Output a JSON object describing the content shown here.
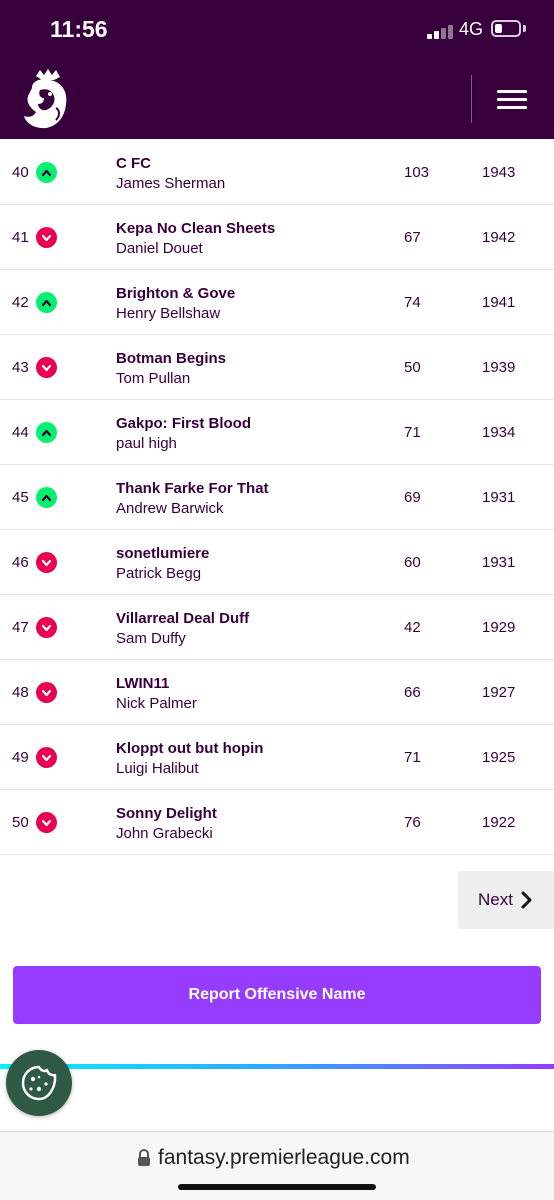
{
  "status_bar": {
    "time": "11:56",
    "network": "4G",
    "battery_level": 0.3
  },
  "header": {
    "logo_icon": "premier-league-lion-icon",
    "menu_icon": "hamburger-menu-icon"
  },
  "colors": {
    "brand_purple": "#37003c",
    "up_green": "#05f06e",
    "down_pink": "#e90052",
    "report_purple": "#963cff"
  },
  "rows": [
    {
      "rank": "40",
      "movement": "up",
      "team": "C FC",
      "manager": "James Sherman",
      "gw": "103",
      "total": "1943"
    },
    {
      "rank": "41",
      "movement": "down",
      "team": "Kepa No Clean Sheets",
      "manager": "Daniel Douet",
      "gw": "67",
      "total": "1942"
    },
    {
      "rank": "42",
      "movement": "up",
      "team": "Brighton & Gove",
      "manager": "Henry Bellshaw",
      "gw": "74",
      "total": "1941"
    },
    {
      "rank": "43",
      "movement": "down",
      "team": "Botman Begins",
      "manager": "Tom Pullan",
      "gw": "50",
      "total": "1939"
    },
    {
      "rank": "44",
      "movement": "up",
      "team": "Gakpo: First Blood",
      "manager": "paul high",
      "gw": "71",
      "total": "1934"
    },
    {
      "rank": "45",
      "movement": "up",
      "team": "Thank Farke For That",
      "manager": "Andrew Barwick",
      "gw": "69",
      "total": "1931"
    },
    {
      "rank": "46",
      "movement": "down",
      "team": "sonetlumiere",
      "manager": "Patrick Begg",
      "gw": "60",
      "total": "1931"
    },
    {
      "rank": "47",
      "movement": "down",
      "team": "Villarreal Deal Duff",
      "manager": "Sam Duffy",
      "gw": "42",
      "total": "1929"
    },
    {
      "rank": "48",
      "movement": "down",
      "team": "LWIN11",
      "manager": "Nick Palmer",
      "gw": "66",
      "total": "1927"
    },
    {
      "rank": "49",
      "movement": "down",
      "team": "Kloppt out but hopin",
      "manager": "Luigi Halibut",
      "gw": "71",
      "total": "1925"
    },
    {
      "rank": "50",
      "movement": "down",
      "team": "Sonny Delight",
      "manager": "John Grabecki",
      "gw": "76",
      "total": "1922"
    }
  ],
  "pagination": {
    "next_label": "Next",
    "next_icon": "chevron-right-icon"
  },
  "report_button": {
    "label": "Report Offensive Name"
  },
  "cookie_button": {
    "icon": "cookie-icon"
  },
  "browser": {
    "url": "fantasy.premierleague.com",
    "lock_icon": "lock-icon"
  }
}
